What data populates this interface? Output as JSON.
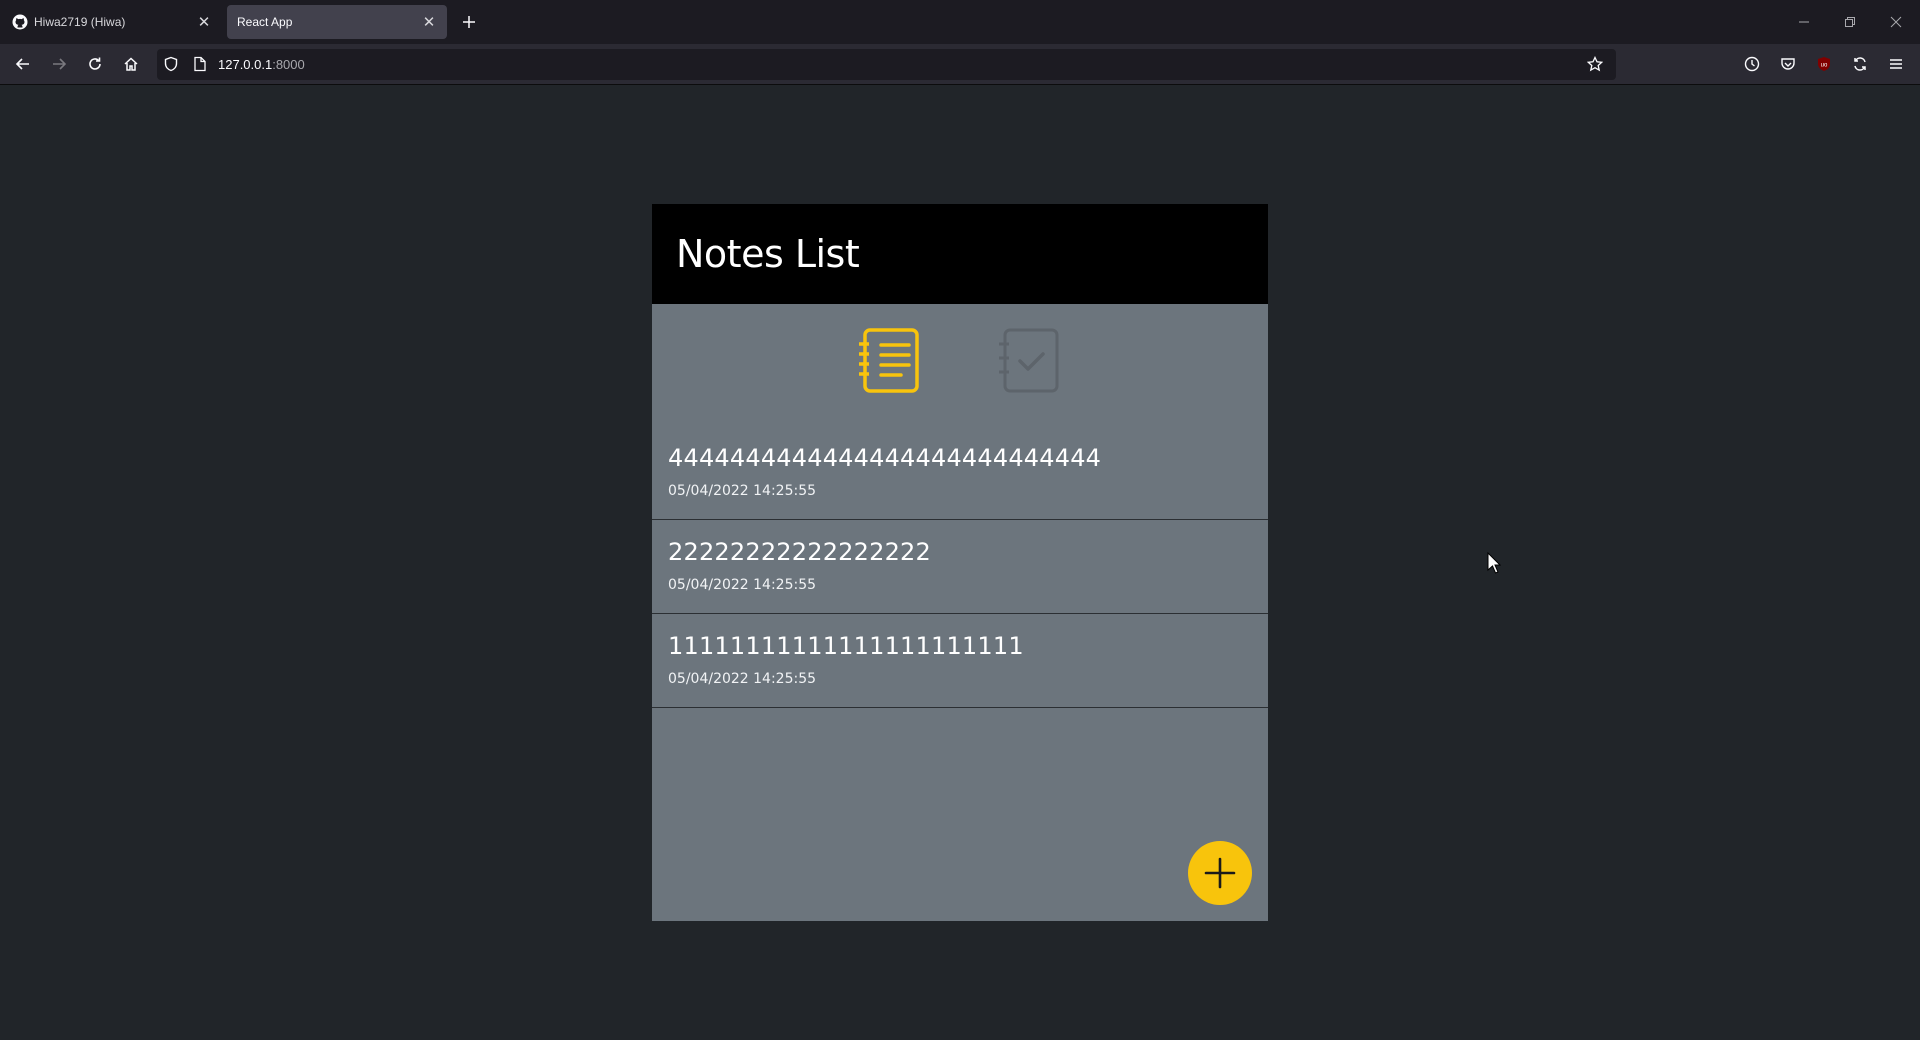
{
  "browser": {
    "tabs": [
      {
        "title": "Hiwa2719 (Hiwa)",
        "active": false
      },
      {
        "title": "React App",
        "active": true
      }
    ],
    "url_host": "127.0.0.1",
    "url_port": ":8000"
  },
  "app": {
    "title": "Notes List",
    "notes": [
      {
        "title": "4444444444444444444444444444",
        "date": "05/04/2022 14:25:55"
      },
      {
        "title": "22222222222222222",
        "date": "05/04/2022 14:25:55"
      },
      {
        "title": "11111111111111111111111",
        "date": "05/04/2022 14:25:55"
      }
    ],
    "colors": {
      "accent": "#f8c40c",
      "header_bg": "#000000",
      "panel_bg": "#6c757d",
      "page_bg": "#212529"
    },
    "icons": {
      "notes": "notebook-list-icon",
      "todo": "notebook-check-icon",
      "add": "plus-icon"
    }
  }
}
